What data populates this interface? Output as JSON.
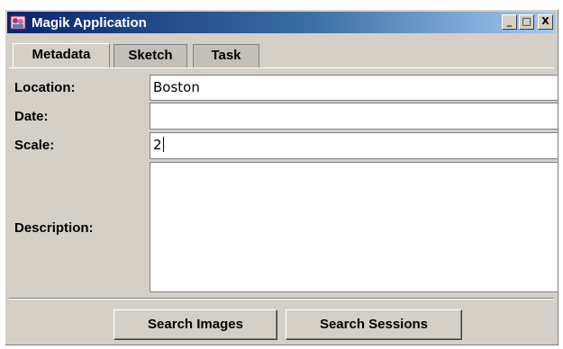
{
  "window": {
    "title": "Magik Application",
    "controls": {
      "minimize": "_",
      "maximize": "□",
      "close": "X"
    }
  },
  "tabs": [
    {
      "label": "Metadata",
      "active": true
    },
    {
      "label": "Sketch",
      "active": false
    },
    {
      "label": "Task",
      "active": false
    }
  ],
  "form": {
    "location": {
      "label": "Location:",
      "value": "Boston"
    },
    "date": {
      "label": "Date:",
      "value": ""
    },
    "scale": {
      "label": "Scale:",
      "value": "2"
    },
    "description": {
      "label": "Description:",
      "value": ""
    }
  },
  "buttons": {
    "search_images": "Search Images",
    "search_sessions": "Search Sessions"
  },
  "colors": {
    "titlebar_start": "#0a246a",
    "titlebar_end": "#a6caf0",
    "window_bg": "#d4d0c8"
  },
  "icons": {
    "app": "magik-app-icon"
  }
}
